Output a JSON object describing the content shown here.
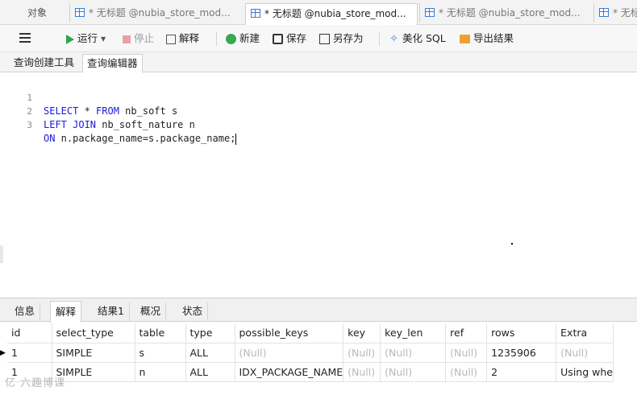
{
  "tabs": {
    "objects": "对象",
    "items": [
      {
        "label": "* 无标题 @nubia_store_mod..."
      },
      {
        "label": "* 无标题 @nubia_store_mod..."
      },
      {
        "label": "* 无标题 @nubia_store_mod..."
      },
      {
        "label": "* 无标"
      }
    ]
  },
  "toolbar": {
    "run": "运行",
    "stop": "停止",
    "explain": "解释",
    "new": "新建",
    "save": "保存",
    "save_as": "另存为",
    "beautify": "美化 SQL",
    "export": "导出结果",
    "beautify_glyph": "✧"
  },
  "subtabs": {
    "builder": "查询创建工具",
    "editor": "查询编辑器"
  },
  "editor": {
    "lines": [
      {
        "num": "1",
        "kw1": "SELECT",
        "mid1": " * ",
        "kw2": "FROM",
        "rest": " nb_soft s"
      },
      {
        "num": "2",
        "kw1": "LEFT JOIN",
        "mid1": " nb_soft_nature n",
        "kw2": "",
        "rest": ""
      },
      {
        "num": "3",
        "kw1": "ON",
        "mid1": " n.package_name=s.package_name;",
        "kw2": "",
        "rest": ""
      }
    ]
  },
  "result_tabs": [
    "信息",
    "解释",
    "结果1",
    "概况",
    "状态"
  ],
  "grid": {
    "columns": [
      "id",
      "select_type",
      "table",
      "type",
      "possible_keys",
      "key",
      "key_len",
      "ref",
      "rows",
      "Extra"
    ],
    "rows": [
      [
        "1",
        "SIMPLE",
        "s",
        "ALL",
        "(Null)",
        "(Null)",
        "(Null)",
        "(Null)",
        "1235906",
        "(Null)"
      ],
      [
        "1",
        "SIMPLE",
        "n",
        "ALL",
        "IDX_PACKAGE_NAME",
        "(Null)",
        "(Null)",
        "(Null)",
        "2",
        "Using whe"
      ]
    ],
    "current_row_marker": "▶"
  },
  "watermark": "亿 六趣博课",
  "colors": {
    "keyword": "#1a1ad8",
    "null_text": "#b8b8b8",
    "run_green": "#2ea44f"
  }
}
